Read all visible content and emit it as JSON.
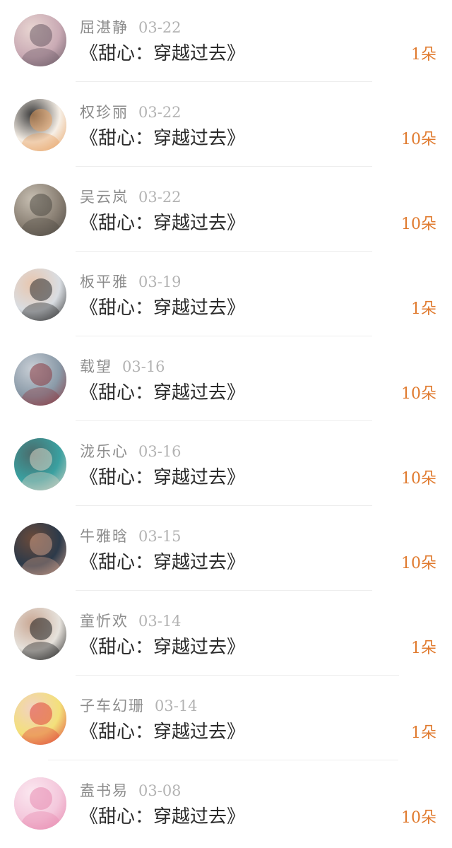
{
  "comments": [
    {
      "name": "屈湛静",
      "date": "03-22",
      "title": "《甜心：穿越过去》",
      "count": "1朵",
      "avatar_colors": [
        "#c9aab4",
        "#6b5b66",
        "#e9d6d2"
      ]
    },
    {
      "name": "权珍丽",
      "date": "03-22",
      "title": "《甜心：穿越过去》",
      "count": "10朵",
      "avatar_colors": [
        "#f6efe6",
        "#e8a060",
        "#3a3a3a"
      ]
    },
    {
      "name": "吴云岚",
      "date": "03-22",
      "title": "《甜心：穿越过去》",
      "count": "10朵",
      "avatar_colors": [
        "#8a8074",
        "#4f4a44",
        "#c7bfb2"
      ]
    },
    {
      "name": "板平雅",
      "date": "03-19",
      "title": "《甜心：穿越过去》",
      "count": "1朵",
      "avatar_colors": [
        "#d9dde2",
        "#2b2b2b",
        "#e8c6ae"
      ]
    },
    {
      "name": "载望",
      "date": "03-16",
      "title": "《甜心：穿越过去》",
      "count": "10朵",
      "avatar_colors": [
        "#8a9aa8",
        "#8b3a42",
        "#c9cfd6"
      ]
    },
    {
      "name": "泷乐心",
      "date": "03-16",
      "title": "《甜心：穿越过去》",
      "count": "10朵",
      "avatar_colors": [
        "#3aa0a0",
        "#d8d3c4",
        "#4b6b6b"
      ]
    },
    {
      "name": "牛雅晗",
      "date": "03-15",
      "title": "《甜心：穿越过去》",
      "count": "10朵",
      "avatar_colors": [
        "#2c3a4a",
        "#c79a86",
        "#6a4a3a"
      ]
    },
    {
      "name": "童忻欢",
      "date": "03-14",
      "title": "《甜心：穿越过去》",
      "count": "1朵",
      "avatar_colors": [
        "#e6e2dc",
        "#1e1e1e",
        "#c9a793"
      ]
    },
    {
      "name": "子车幻珊",
      "date": "03-14",
      "title": "《甜心：穿越过去》",
      "count": "1朵",
      "avatar_colors": [
        "#f3e07a",
        "#e0433a",
        "#f2d2c2"
      ]
    },
    {
      "name": "盍书易",
      "date": "03-08",
      "title": "《甜心：穿越过去》",
      "count": "10朵",
      "avatar_colors": [
        "#f4c8dc",
        "#e88ab0",
        "#fbe8f0"
      ]
    }
  ]
}
